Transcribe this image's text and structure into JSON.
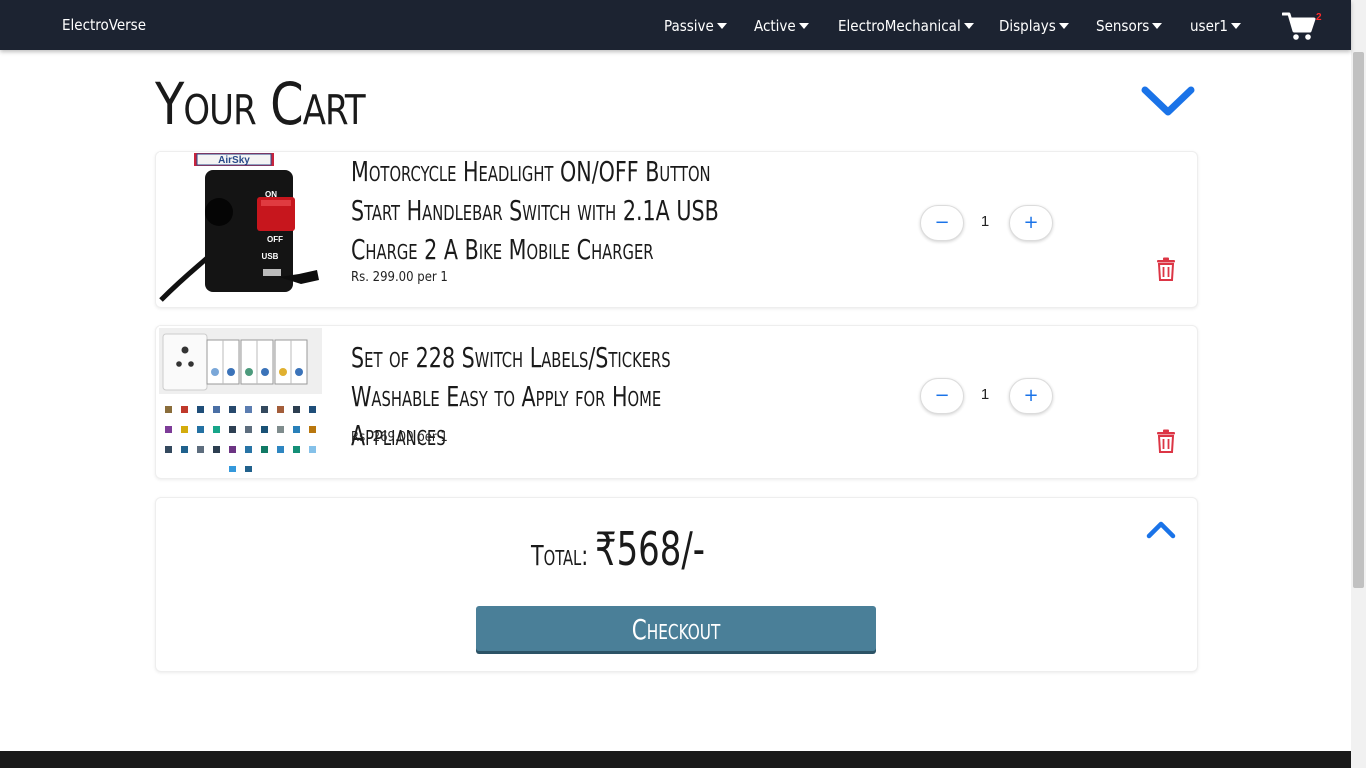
{
  "navbar": {
    "brand": "ElectroVerse",
    "items": [
      {
        "label": "Passive"
      },
      {
        "label": "Active"
      },
      {
        "label": "ElectroMechanical"
      },
      {
        "label": "Displays"
      },
      {
        "label": "Sensors"
      },
      {
        "label": "user1"
      }
    ],
    "cart_icon": "shopping-cart-icon",
    "cart_count": "2"
  },
  "page": {
    "title": "Your Cart",
    "collapse_icon": "chevron-down-icon"
  },
  "cart": {
    "items": [
      {
        "name": "Motorcycle Headlight ON/OFF Button Start Handlebar Switch with 2.1A USB Charge 2 A Bike Mobile Charger",
        "price": "Rs. 299.00 per 1",
        "quantity": "1",
        "image_brand": "AirSky",
        "image_labels": {
          "on": "ON",
          "off": "OFF",
          "usb": "USB"
        }
      },
      {
        "name": "Set of 228 Switch Labels/Stickers Washable Easy to Apply for Home Appliances",
        "price": "Rs. 269.00 per 1",
        "quantity": "1"
      }
    ],
    "decrement_label": "−",
    "increment_label": "+",
    "remove_icon": "trash-icon"
  },
  "summary": {
    "total_label": "Total:",
    "total_amount": "₹568/-",
    "checkout_label": "Checkout",
    "collapse_icon": "chevron-up-icon"
  },
  "colors": {
    "navbar": "#1c2331",
    "accent": "#1a73e8",
    "checkout": "#4a7f98",
    "danger": "#dc3545",
    "badge": "#ff2b2b"
  }
}
